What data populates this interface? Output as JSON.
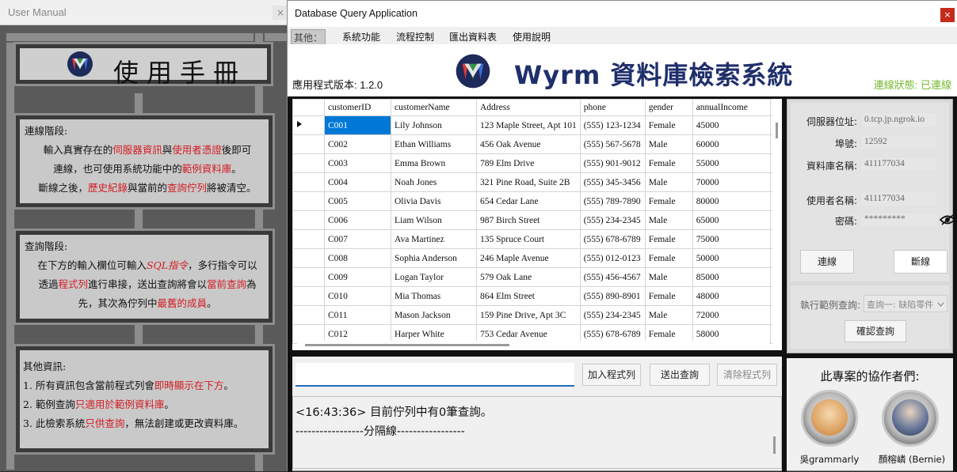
{
  "manual": {
    "window_title": "User Manual",
    "close": "×",
    "title": "使用手冊",
    "connect": {
      "heading": "連線階段:",
      "p1a": "輸入真實存在的",
      "p1b": "伺服器資訊",
      "p1c": "與",
      "p1d": "使用者憑證",
      "p1e": "後即可",
      "p2a": "連線，也可使用系統功能中的",
      "p2b": "範例資料庫",
      "p2c": "。",
      "p3a": "斷線之後，",
      "p3b": "歷史紀錄",
      "p3c": "與當前的",
      "p3d": "查詢佇列",
      "p3e": "將被清空。"
    },
    "query": {
      "heading": "查詢階段:",
      "p1a": "在下方的輸入欄位可輸入",
      "p1b": "SQL指令",
      "p1c": "，多行指令可以",
      "p2a": "透過",
      "p2b": "程式列",
      "p2c": "進行串接，送出查詢將會以",
      "p2d": "當前查詢",
      "p2e": "為",
      "p3a": "先，其次為佇列中",
      "p3b": "最舊的成員",
      "p3c": "。"
    },
    "other": {
      "heading": "其他資訊:",
      "p1a": "1. 所有資訊包含當前程式列會",
      "p1b": "即時顯示在下方",
      "p1c": "。",
      "p2a": "2. 範例查詢",
      "p2b": "只適用於範例資料庫",
      "p2c": "。",
      "p3a": "3. 此檢索系統",
      "p3b": "只供查詢",
      "p3c": "，無法創建或更改資料庫。"
    }
  },
  "app": {
    "window_title": "Database Query Application",
    "close": "×",
    "menu": [
      "其他：",
      "系統功能",
      "流程控制",
      "匯出資料表",
      "使用說明"
    ],
    "brand": "Wyrm 資料庫檢索系統",
    "version": "應用程式版本: 1.2.0",
    "status": "連線狀態: 已連線",
    "colors": {
      "accent_blue": "#1f2f6b",
      "status_green": "#79b933",
      "selection": "#0078d7"
    }
  },
  "grid": {
    "columns": [
      "customerID",
      "customerName",
      "Address",
      "phone",
      "gender",
      "annualIncome"
    ],
    "rows": [
      [
        "C001",
        "Lily Johnson",
        "123 Maple Street, Apt 101",
        "(555) 123-1234",
        "Female",
        "45000"
      ],
      [
        "C002",
        "Ethan Williams",
        "456 Oak Avenue",
        "(555) 567-5678",
        "Male",
        "60000"
      ],
      [
        "C003",
        "Emma Brown",
        "789 Elm Drive",
        "(555) 901-9012",
        "Female",
        "55000"
      ],
      [
        "C004",
        "Noah Jones",
        "321 Pine Road, Suite 2B",
        "(555) 345-3456",
        "Male",
        "70000"
      ],
      [
        "C005",
        "Olivia Davis",
        "654 Cedar Lane",
        "(555) 789-7890",
        "Female",
        "80000"
      ],
      [
        "C006",
        "Liam Wilson",
        "987 Birch Street",
        "(555) 234-2345",
        "Male",
        "65000"
      ],
      [
        "C007",
        "Ava Martinez",
        "135 Spruce Court",
        "(555) 678-6789",
        "Female",
        "75000"
      ],
      [
        "C008",
        "Sophia Anderson",
        "246 Maple Avenue",
        "(555) 012-0123",
        "Female",
        "50000"
      ],
      [
        "C009",
        "Logan Taylor",
        "579 Oak Lane",
        "(555) 456-4567",
        "Male",
        "85000"
      ],
      [
        "C010",
        "Mia Thomas",
        "864 Elm Street",
        "(555) 890-8901",
        "Female",
        "48000"
      ],
      [
        "C011",
        "Mason Jackson",
        "159 Pine Drive, Apt 3C",
        "(555) 234-2345",
        "Male",
        "72000"
      ],
      [
        "C012",
        "Harper White",
        "753 Cedar Avenue",
        "(555) 678-6789",
        "Female",
        "58000"
      ]
    ],
    "selected_cell": "C001"
  },
  "server": {
    "host_label": "伺服器位址:",
    "host": "0.tcp.jp.ngrok.io",
    "port_label": "埠號:",
    "port": "12592",
    "db_label": "資料庫名稱:",
    "db": "411177034",
    "user_label": "使用者名稱:",
    "user": "411177034",
    "pw_label": "密碼:",
    "pw": "*********",
    "connect_btn": "連線",
    "disconnect_btn": "斷線"
  },
  "example": {
    "label": "執行範例查詢:",
    "selected": "查詢一: 缺陷零件",
    "confirm_btn": "確認查詢"
  },
  "query": {
    "input_value": "",
    "add_btn": "加入程式列",
    "send_btn": "送出查詢",
    "clear_btn": "清除程式列",
    "log_line1": "<16:43:36> 目前佇列中有0筆查詢。",
    "log_line2": "-----------------分隔線-----------------"
  },
  "collab": {
    "heading": "此專案的協作者們:",
    "people": [
      "吳grammarly",
      "顏榕嶙 (Bernie)"
    ]
  }
}
